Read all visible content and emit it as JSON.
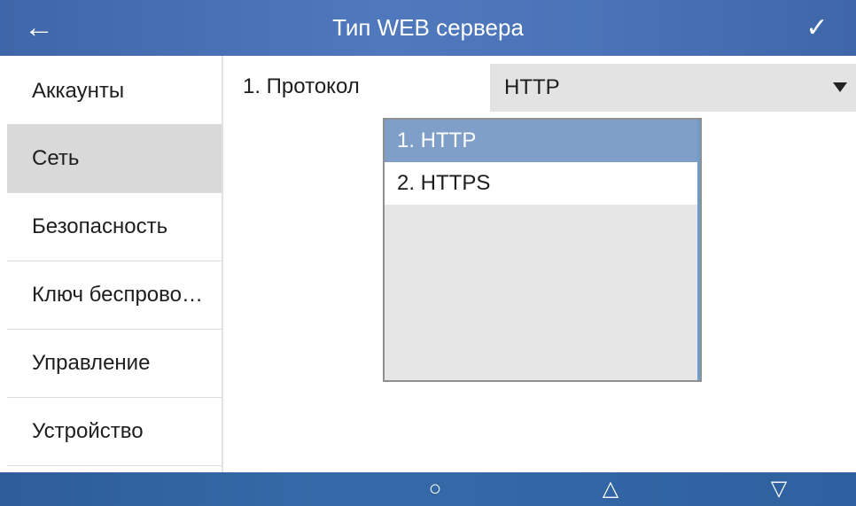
{
  "header": {
    "title": "Тип WEB сервера",
    "back_icon": "←",
    "confirm_icon": "✓"
  },
  "sidebar": {
    "items": [
      {
        "label": "Аккаунты",
        "active": false
      },
      {
        "label": "Сеть",
        "active": true
      },
      {
        "label": "Безопасность",
        "active": false
      },
      {
        "label": "Ключ беспрово…",
        "active": false
      },
      {
        "label": "Управление",
        "active": false
      },
      {
        "label": "Устройство",
        "active": false
      }
    ]
  },
  "main": {
    "field_label": "1. Протокол",
    "select_value": "HTTP",
    "options": [
      {
        "label": "1. HTTP",
        "selected": true
      },
      {
        "label": "2. HTTPS",
        "selected": false
      }
    ]
  },
  "footer": {
    "circle": "○",
    "up": "△",
    "down": "▽"
  },
  "colors": {
    "header": "#4a73b8",
    "selected_option": "#7f9fc8",
    "active_sidebar": "#d9d9d9"
  }
}
